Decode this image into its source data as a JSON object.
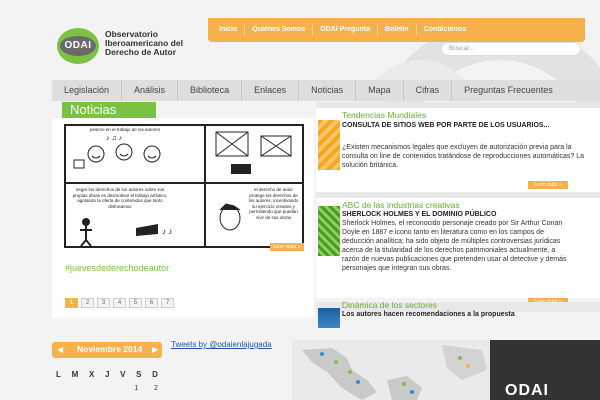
{
  "brand": {
    "logo_text": "ODAI",
    "name": "Observatorio Iberoamericano del Derecho de Autor"
  },
  "top_nav": [
    "Inicio",
    "Quiénes Somos",
    "ODAI Pregunta",
    "Boletín",
    "Contáctenos"
  ],
  "search": {
    "placeholder": "Buscar..."
  },
  "main_nav": [
    "Legislación",
    "Análisis",
    "Biblioteca",
    "Enlaces",
    "Noticias",
    "Mapa",
    "Cifras",
    "Preguntas Frecuentes"
  ],
  "news": {
    "tab_label": "Noticias",
    "comic_captions": [
      "pesimo en el trabajo de los autores",
      "negar los derechos de los autores sobre sus propias obras es desmotivar el trabajo artístico, agotando la oferta de contenidos que tanto disfrutamos",
      "el derecho de autor protege los derechos de los autores, incentivando su ejercicio creativo y permitiendo que puedan vivir de sus obras"
    ],
    "read_more": "Leer más »",
    "hashtag": "#juevesdederechodeautor",
    "pages": [
      "1",
      "2",
      "3",
      "4",
      "5",
      "6",
      "7"
    ],
    "active_page": "1"
  },
  "right_items": [
    {
      "title": "Tendencias Mundiales",
      "headline": "CONSULTA DE SITIOS WEB POR PARTE DE LOS USUARIOS...",
      "body": "¿Existen mecanismos legales que excluyen de autorización previa para la consulta on line de contenidos tratándose de reproducciones automáticas? La solución británica.",
      "read_more": "Leer más »",
      "thumb_color": "#f6a623"
    },
    {
      "title": "ABC de las industrias creativas",
      "headline": "SHERLOCK HOLMES Y EL DOMINIO PÚBLICO",
      "body": "Sherlock Holmes, el reconocido personaje creado por Sir Arthur Conan Doyle en 1887 e icono tanto en literatura como en los campos de deducción analítica; ha sido objeto de múltiples controversias jurídicas acerca de la titularidad de los derechos patrimoniales actualmente, a razón de nuevas publicaciones que pretenden usar al detective y demás personajes que integran sus obras.",
      "read_more": "Leer más »",
      "thumb_color": "#5aa832"
    },
    {
      "title": "Dinámica de los sectores",
      "headline": "Los autores hacen recomendaciones a la propuesta",
      "thumb_color": "#2a6fb0"
    }
  ],
  "calendar": {
    "month": "Noviembre 2014",
    "prev_arrow": "◀",
    "next_arrow": "▶",
    "days": [
      "L",
      "M",
      "X",
      "J",
      "V",
      "S",
      "D"
    ],
    "first_row": [
      "",
      "",
      "",
      "",
      "",
      "1",
      "2"
    ]
  },
  "twitter": {
    "link_text": "Tweets by @odaienlajugada"
  },
  "odai_box": {
    "text": "ODAI"
  },
  "colors": {
    "accent_orange": "#f6b04c",
    "accent_green": "#7cc242",
    "nav_gray": "#dedede"
  }
}
